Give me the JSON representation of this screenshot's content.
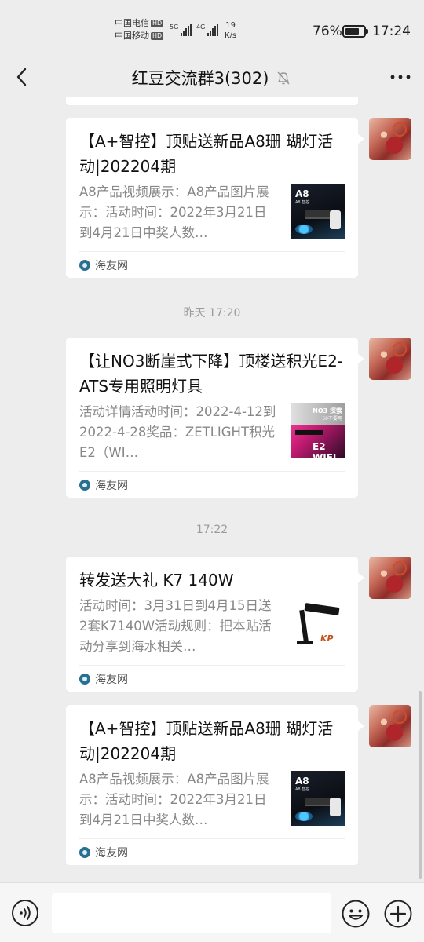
{
  "status_bar": {
    "carrier_1": "中国电信",
    "carrier_2": "中国移动",
    "hd_badge": "HD",
    "signal_1_label": "5G",
    "signal_2_label": "4G",
    "net_speed_value": "19",
    "net_speed_unit": "K/s",
    "battery_level": 76,
    "battery_text": "76%",
    "time": "17:24"
  },
  "header": {
    "title": "红豆交流群3(302)",
    "back_icon": "chevron-left-icon",
    "mute_icon": "bell-off-icon",
    "more_icon": "more-dots-icon"
  },
  "messages": [
    {
      "type": "link-card",
      "title": "【A+智控】顶贴送新品A8珊 瑚灯活动|202204期",
      "description": "A8产品视频展示：A8产品图片展示：活动时间：2022年3月21日到4月21日中奖人数…",
      "thumbnail": {
        "heading": "A8",
        "caption": "A8 智控"
      },
      "source": "海友网"
    },
    {
      "type": "time",
      "text": "昨天 17:20"
    },
    {
      "type": "link-card",
      "title": "【让NO3断崖式下降】顶楼送积光E2-ATS专用照明灯具",
      "description": "活动详情活动时间：2022-4-12到2022-4-28奖品：ZETLIGHT积光E2（WI…",
      "thumbnail": {
        "heading": "NO3 探索",
        "subheading": "50不要用",
        "label": "E2 WIFI"
      },
      "source": "海友网"
    },
    {
      "type": "time",
      "text": "17:22"
    },
    {
      "type": "link-card",
      "title": "转发送大礼 K7 140W",
      "description": "活动时间：3月31日到4月15日送2套K7140W活动规则：把本贴活动分享到海水相关…",
      "thumbnail": {
        "logo": "KP"
      },
      "source": "海友网"
    },
    {
      "type": "link-card",
      "title": "【A+智控】顶贴送新品A8珊 瑚灯活动|202204期",
      "description": "A8产品视频展示：A8产品图片展示：活动时间：2022年3月21日到4月21日中奖人数…",
      "thumbnail": {
        "heading": "A8",
        "caption": "A8 智控"
      },
      "source": "海友网"
    }
  ],
  "input_bar": {
    "value": "",
    "voice_icon": "voice-icon",
    "emoji_icon": "emoji-icon",
    "plus_icon": "plus-circle-icon"
  },
  "colors": {
    "background": "#ededed",
    "bubble": "#ffffff",
    "secondary_text": "#888888",
    "time_text": "#9a9a9a"
  }
}
